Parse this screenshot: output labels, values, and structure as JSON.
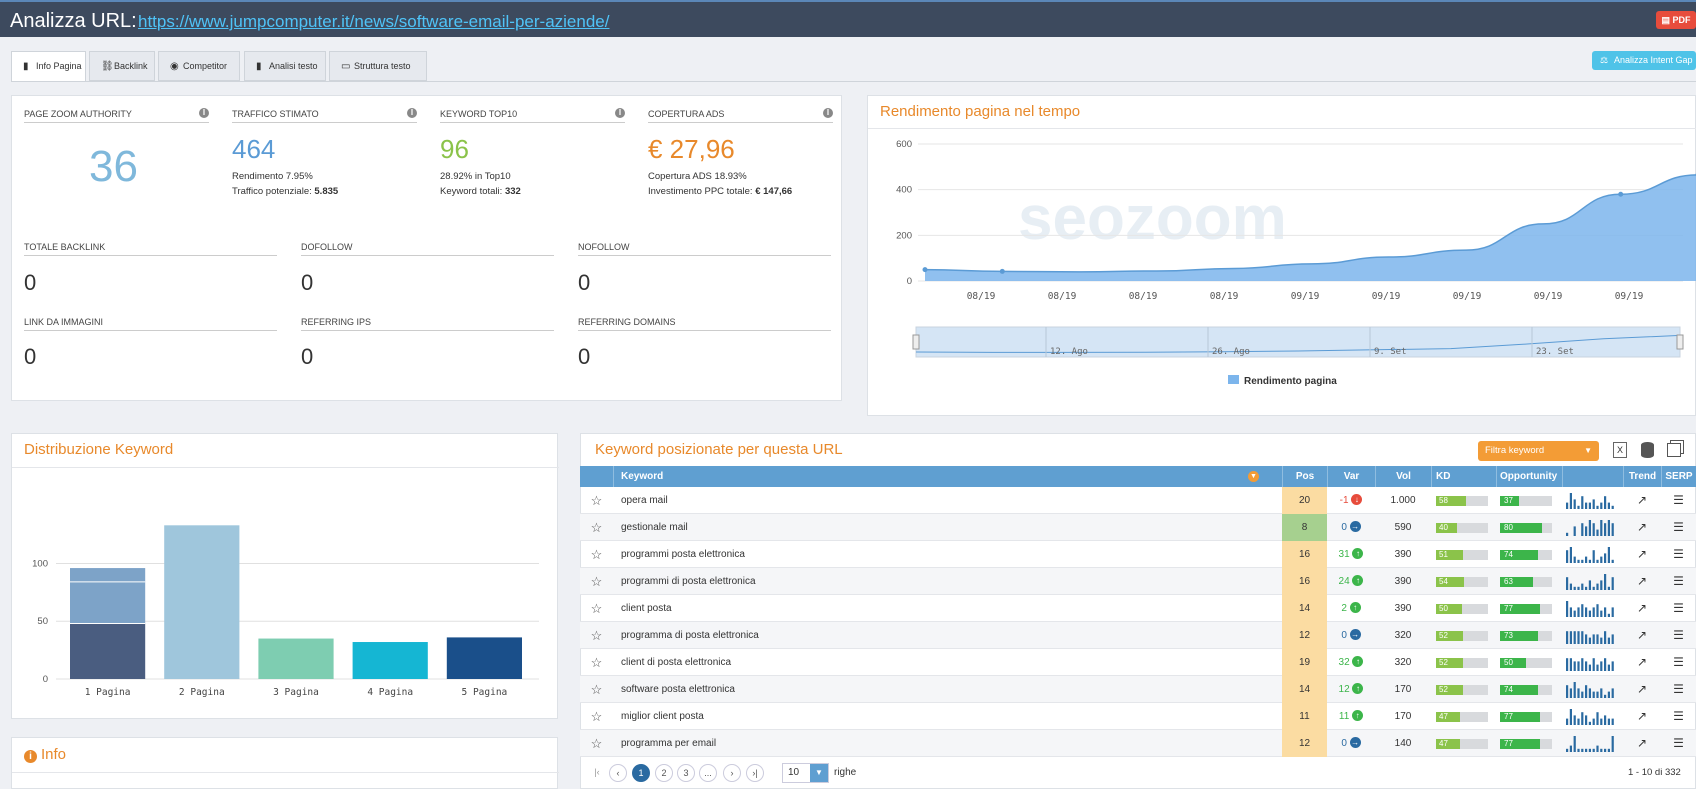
{
  "header": {
    "label": "Analizza URL:",
    "url": "https://www.jumpcomputer.it/news/software-email-per-aziende/",
    "pdf": "PDF"
  },
  "tabs": [
    {
      "label": "Info Pagina",
      "icon": "document-icon"
    },
    {
      "label": "Backlink",
      "icon": "link-icon"
    },
    {
      "label": "Competitor",
      "icon": "eye-icon"
    },
    {
      "label": "Analisi testo",
      "icon": "file-icon"
    },
    {
      "label": "Struttura testo",
      "icon": "layout-icon"
    }
  ],
  "intent_button": "Analizza Intent Gap",
  "metrics": [
    {
      "title": "PAGE ZOOM AUTHORITY",
      "value": "36",
      "color": "#7fb8db"
    },
    {
      "title": "TRAFFICO STIMATO",
      "value": "464",
      "color": "#5b9bd5",
      "line1": "Rendimento 7.95%",
      "line2_label": "Traffico potenziale:",
      "line2_value": "5.835"
    },
    {
      "title": "KEYWORD TOP10",
      "value": "96",
      "color": "#8bc34a",
      "line1": "28.92% in Top10",
      "line2_label": "Keyword totali:",
      "line2_value": "332"
    },
    {
      "title": "COPERTURA ADS",
      "value": "€ 27,96",
      "color": "#e8892b",
      "line1": "Copertura ADS 18.93%",
      "line2_label": "Investimento PPC totale:",
      "line2_value": "€ 147,66"
    }
  ],
  "backlinks": [
    {
      "title": "TOTALE BACKLINK",
      "value": "0"
    },
    {
      "title": "DOFOLLOW",
      "value": "0"
    },
    {
      "title": "NOFOLLOW",
      "value": "0"
    },
    {
      "title": "LINK DA IMMAGINI",
      "value": "0"
    },
    {
      "title": "REFERRING IPS",
      "value": "0"
    },
    {
      "title": "REFERRING DOMAINS",
      "value": "0"
    }
  ],
  "perf_chart": {
    "title": "Rendimento pagina nel tempo",
    "watermark": "seozoom",
    "legend": "Rendimento pagina",
    "navigator_labels": [
      "12. Ago",
      "26. Ago",
      "9. Set",
      "23. Set"
    ]
  },
  "dist_title": "Distribuzione Keyword",
  "info_title": "Info",
  "kw_panel": {
    "title": "Keyword posizionate per questa URL",
    "filter_label": "Filtra keyword",
    "headers": {
      "keyword": "Keyword",
      "pos": "Pos",
      "var": "Var",
      "vol": "Vol",
      "kd": "KD",
      "opportunity": "Opportunity",
      "trend": "Trend",
      "serp": "SERP"
    },
    "rows": [
      {
        "keyword": "opera mail",
        "pos": "20",
        "var": "-1",
        "dir": "down",
        "vol": "1.000",
        "kd": 58,
        "op": 37,
        "spark": [
          2,
          5,
          3,
          1,
          4,
          2,
          2,
          3,
          1,
          2,
          4,
          2,
          1
        ]
      },
      {
        "keyword": "gestionale mail",
        "pos": "8",
        "var": "0",
        "dir": "flat",
        "vol": "590",
        "kd": 40,
        "op": 80,
        "spark": [
          1,
          0,
          3,
          0,
          4,
          3,
          5,
          4,
          2,
          5,
          4,
          5,
          4
        ]
      },
      {
        "keyword": "programmi posta elettronica",
        "pos": "16",
        "var": "31",
        "dir": "up",
        "vol": "390",
        "kd": 51,
        "op": 74,
        "spark": [
          4,
          5,
          2,
          1,
          1,
          2,
          1,
          4,
          1,
          2,
          3,
          5,
          1
        ]
      },
      {
        "keyword": "programmi di posta elettronica",
        "pos": "16",
        "var": "24",
        "dir": "up",
        "vol": "390",
        "kd": 54,
        "op": 63,
        "spark": [
          4,
          2,
          1,
          1,
          2,
          1,
          3,
          1,
          2,
          3,
          5,
          1,
          4
        ]
      },
      {
        "keyword": "client posta",
        "pos": "14",
        "var": "2",
        "dir": "up",
        "vol": "390",
        "kd": 50,
        "op": 77,
        "spark": [
          5,
          3,
          2,
          3,
          4,
          3,
          2,
          3,
          4,
          2,
          3,
          1,
          3
        ]
      },
      {
        "keyword": "programma di posta elettronica",
        "pos": "12",
        "var": "0",
        "dir": "flat",
        "vol": "320",
        "kd": 52,
        "op": 73,
        "spark": [
          4,
          4,
          4,
          4,
          4,
          3,
          2,
          3,
          3,
          2,
          4,
          2,
          3
        ]
      },
      {
        "keyword": "client di posta elettronica",
        "pos": "19",
        "var": "32",
        "dir": "up",
        "vol": "320",
        "kd": 52,
        "op": 50,
        "spark": [
          4,
          4,
          3,
          3,
          4,
          3,
          2,
          4,
          2,
          3,
          4,
          2,
          3
        ]
      },
      {
        "keyword": "software posta elettronica",
        "pos": "14",
        "var": "12",
        "dir": "up",
        "vol": "170",
        "kd": 52,
        "op": 74,
        "spark": [
          4,
          3,
          5,
          3,
          2,
          4,
          3,
          2,
          2,
          3,
          1,
          2,
          3
        ]
      },
      {
        "keyword": "miglior client posta",
        "pos": "11",
        "var": "11",
        "dir": "up",
        "vol": "170",
        "kd": 47,
        "op": 77,
        "spark": [
          2,
          5,
          3,
          2,
          4,
          3,
          1,
          2,
          4,
          2,
          3,
          2,
          2
        ]
      },
      {
        "keyword": "programma per email",
        "pos": "12",
        "var": "0",
        "dir": "flat",
        "vol": "140",
        "kd": 47,
        "op": 77,
        "spark": [
          1,
          2,
          5,
          1,
          1,
          1,
          1,
          1,
          2,
          1,
          1,
          1,
          5
        ]
      }
    ],
    "pagination": {
      "pages": [
        "1",
        "2",
        "3",
        "..."
      ],
      "rows_value": "10",
      "rows_label": "righe",
      "range": "1 - 10 di 332"
    }
  },
  "chart_data": [
    {
      "type": "area",
      "title": "Rendimento pagina nel tempo",
      "x": [
        "08/19",
        "08/19",
        "08/19",
        "08/19",
        "09/19",
        "09/19",
        "09/19",
        "09/19",
        "09/19"
      ],
      "y_ticks": [
        0,
        200,
        400,
        600
      ],
      "ylim": [
        0,
        600
      ],
      "series": [
        {
          "name": "Rendimento pagina",
          "values": [
            50,
            42,
            40,
            44,
            55,
            75,
            105,
            135,
            250,
            380,
            465
          ]
        }
      ],
      "color": "#7cb5ec"
    },
    {
      "type": "bar",
      "categories": [
        "1 Pagina",
        "2 Pagina",
        "3 Pagina",
        "4 Pagina",
        "5 Pagina"
      ],
      "y_ticks": [
        0,
        50,
        100
      ],
      "ylim": [
        0,
        135
      ],
      "values": [
        96,
        133,
        35,
        32,
        36
      ],
      "segments": [
        [
          48,
          48
        ],
        [
          133
        ],
        [
          35
        ],
        [
          32
        ],
        [
          36
        ]
      ],
      "colors": [
        "#4a5d80",
        "#9fc6dc",
        "#7ecdb1",
        "#15b6d3",
        "#1a4f8a"
      ],
      "segment_top_color": "#7da3c8"
    }
  ]
}
